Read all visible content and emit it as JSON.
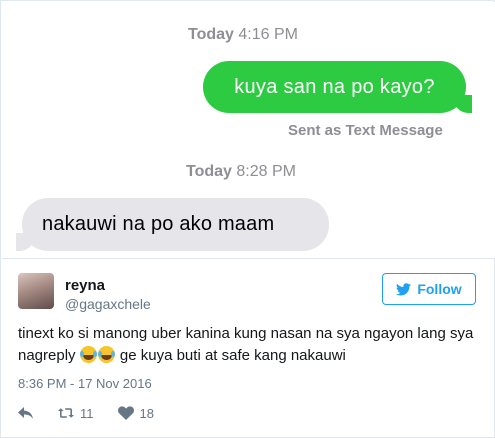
{
  "imessage": {
    "timestamp1": {
      "day": "Today",
      "time": "4:16 PM"
    },
    "outgoing_message": "kuya san na po kayo?",
    "delivery_status": "Sent as Text Message",
    "timestamp2": {
      "day": "Today",
      "time": "8:28 PM"
    },
    "incoming_message": "nakauwi na po ako maam",
    "colors": {
      "outgoing_bubble": "#2ccb42",
      "incoming_bubble": "#e6e5ea"
    }
  },
  "tweet": {
    "display_name": "reyna",
    "handle": "@gagaxchele",
    "follow_label": "Follow",
    "text_before_emoji": "tinext ko si manong uber kanina kung nasan na sya ngayon lang sya nagreply ",
    "emoji_names": [
      "face-with-tears-of-joy",
      "face-with-tears-of-joy"
    ],
    "text_after_emoji": " ge kuya buti at safe kang nakauwi",
    "timestamp": "8:36 PM - 17 Nov 2016",
    "retweet_count": "11",
    "like_count": "18",
    "colors": {
      "accent": "#1da1f2",
      "secondary_text": "#657786"
    }
  }
}
